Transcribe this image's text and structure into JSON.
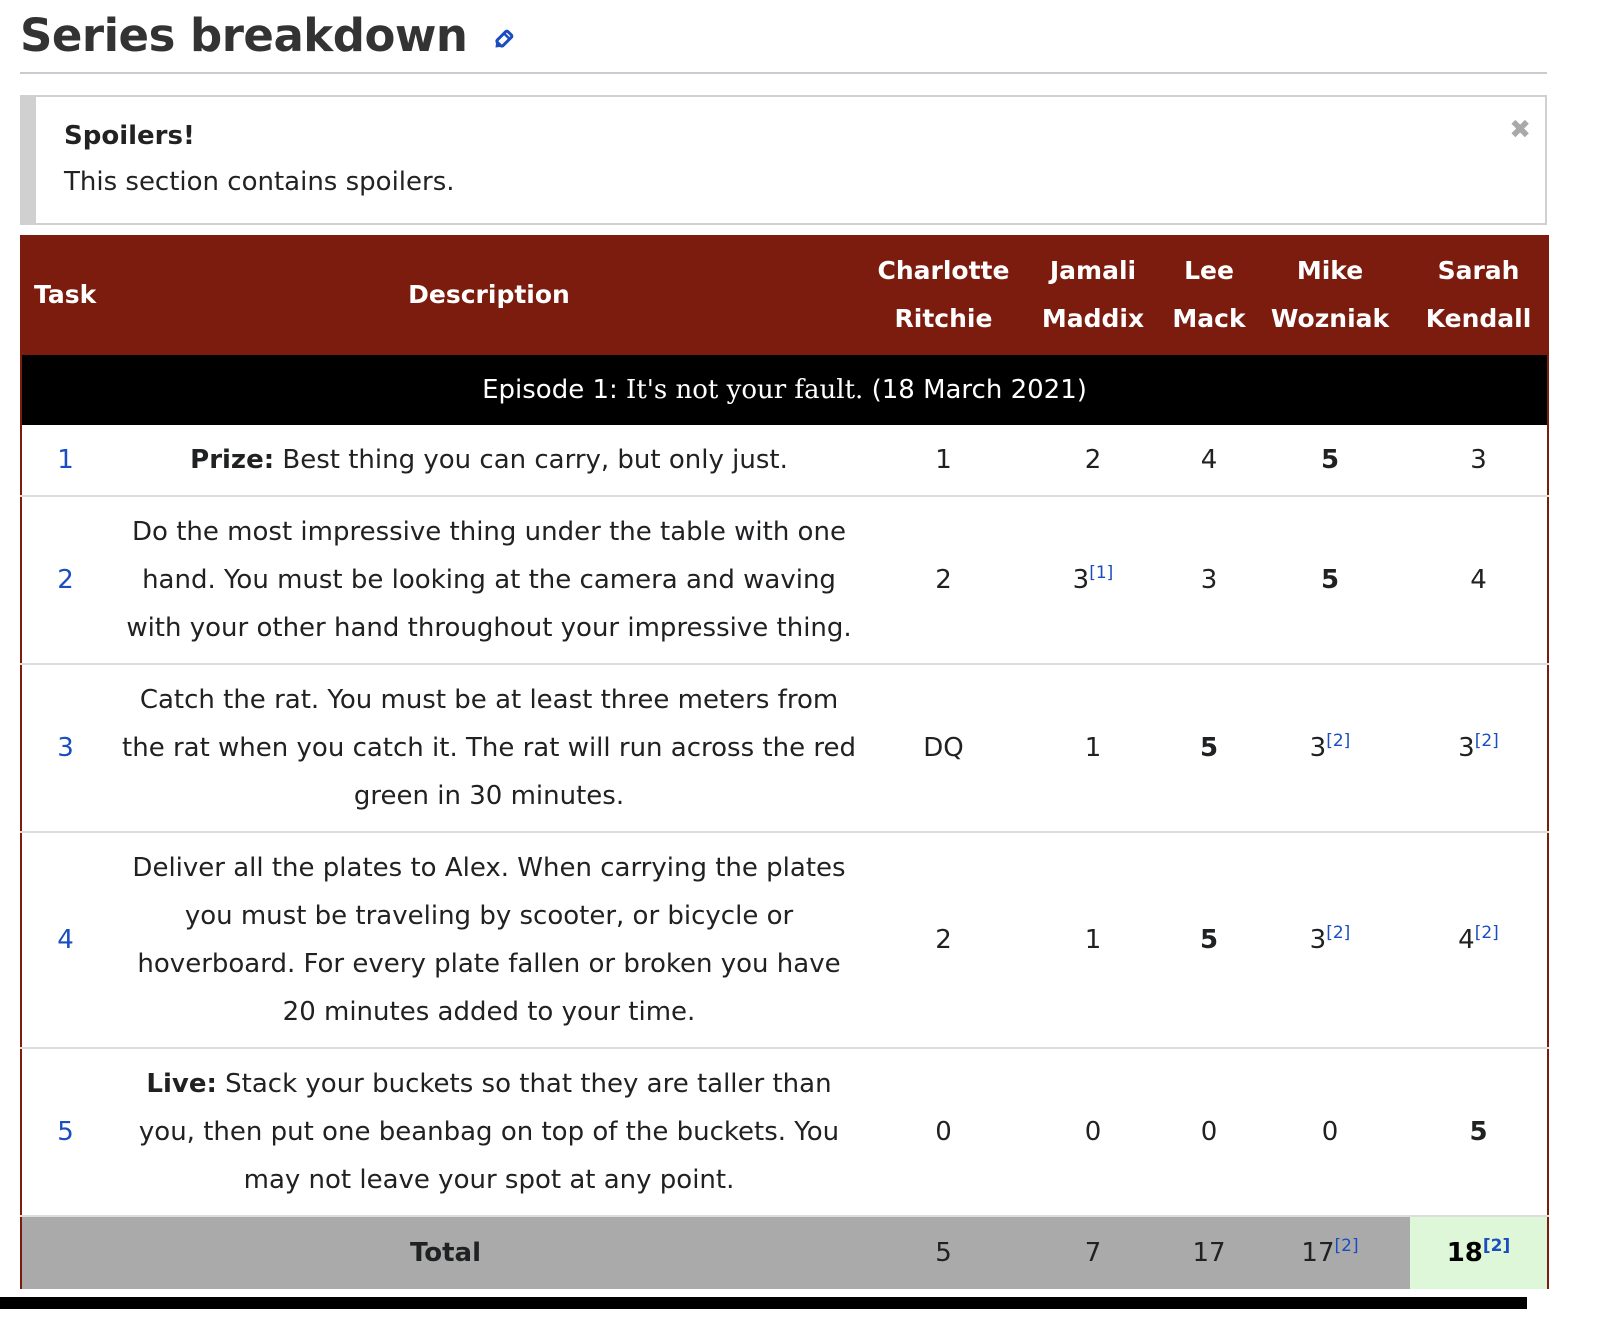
{
  "heading": "Series breakdown",
  "spoiler": {
    "title": "Spoilers!",
    "text": "This section contains spoilers.",
    "close_symbol": "✖"
  },
  "table": {
    "headers": {
      "task": "Task",
      "description": "Description",
      "contestants": [
        {
          "first": "Charlotte",
          "last": "Ritchie"
        },
        {
          "first": "Jamali",
          "last": "Maddix"
        },
        {
          "first": "Lee",
          "last": "Mack"
        },
        {
          "first": "Mike",
          "last": "Wozniak"
        },
        {
          "first": "Sarah",
          "last": "Kendall"
        }
      ]
    },
    "episode": {
      "prefix": "Episode 1:",
      "title": "It's not your fault.",
      "date": "(18 March 2021)"
    },
    "rows": [
      {
        "task": "1",
        "desc_bold": "Prize:",
        "desc": "Best thing you can carry, but only just.",
        "scores": [
          {
            "v": "1"
          },
          {
            "v": "2"
          },
          {
            "v": "4"
          },
          {
            "v": "5",
            "bold": true
          },
          {
            "v": "3"
          }
        ]
      },
      {
        "task": "2",
        "desc_bold": "",
        "desc": "Do the most impressive thing under the table with one hand. You must be looking at the camera and waving with your other hand throughout your impressive thing.",
        "scores": [
          {
            "v": "2"
          },
          {
            "v": "3",
            "note": "[1]"
          },
          {
            "v": "3"
          },
          {
            "v": "5",
            "bold": true
          },
          {
            "v": "4"
          }
        ]
      },
      {
        "task": "3",
        "desc_bold": "",
        "desc": "Catch the rat. You must be at least three meters from the rat when you catch it. The rat will run across the red green in 30 minutes.",
        "scores": [
          {
            "v": "DQ"
          },
          {
            "v": "1"
          },
          {
            "v": "5",
            "bold": true
          },
          {
            "v": "3",
            "note": "[2]"
          },
          {
            "v": "3",
            "note": "[2]"
          }
        ]
      },
      {
        "task": "4",
        "desc_bold": "",
        "desc": "Deliver all the plates to Alex. When carrying the plates you must be traveling by scooter, or bicycle or hoverboard. For every plate fallen or broken you have 20 minutes added to your time.",
        "scores": [
          {
            "v": "2"
          },
          {
            "v": "1"
          },
          {
            "v": "5",
            "bold": true
          },
          {
            "v": "3",
            "note": "[2]"
          },
          {
            "v": "4",
            "note": "[2]"
          }
        ]
      },
      {
        "task": "5",
        "desc_bold": "Live:",
        "desc": "Stack your buckets so that they are taller than you, then put one beanbag on top of the buckets. You may not leave your spot at any point.",
        "scores": [
          {
            "v": "0"
          },
          {
            "v": "0"
          },
          {
            "v": "0"
          },
          {
            "v": "0"
          },
          {
            "v": "5",
            "bold": true
          }
        ]
      }
    ],
    "total": {
      "label": "Total",
      "scores": [
        {
          "v": "5"
        },
        {
          "v": "7"
        },
        {
          "v": "17"
        },
        {
          "v": "17",
          "note": "[2]"
        },
        {
          "v": "18",
          "note": "[2]",
          "winner": true
        }
      ]
    }
  },
  "colors": {
    "header_bg": "#7b1c0e",
    "episode_bg": "#000000",
    "total_bg": "#aaaaaa",
    "winner_bg": "#dff7d9",
    "link": "#1a4dbf"
  },
  "icons": {
    "edit": "pencil-icon",
    "close": "close-icon"
  }
}
